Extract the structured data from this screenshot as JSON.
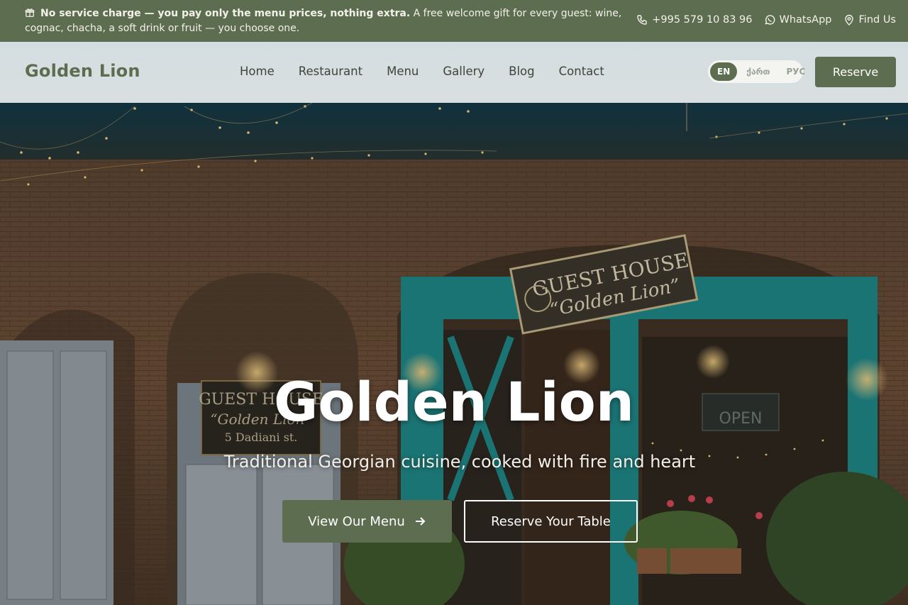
{
  "topbar": {
    "notice_bold": "No service charge — you pay only the menu prices, nothing extra.",
    "notice_text": " A free welcome gift for every guest: wine, cognac, chacha, a soft drink or fruit — you choose one.",
    "phone": "+995 579 10 83 96",
    "whatsapp": "WhatsApp",
    "find_us": "Find Us"
  },
  "header": {
    "logo": "Golden Lion",
    "nav": [
      "Home",
      "Restaurant",
      "Menu",
      "Gallery",
      "Blog",
      "Contact"
    ],
    "languages": [
      "EN",
      "ქართ",
      "РУС"
    ],
    "active_language": "EN",
    "reserve_label": "Reserve"
  },
  "hero": {
    "title": "Golden Lion",
    "subtitle": "Traditional Georgian cuisine, cooked with fire and heart",
    "menu_button": "View Our Menu",
    "reserve_button": "Reserve Your Table"
  },
  "photo_signs": {
    "hanging_sign_line1": "GUEST HOUSE",
    "hanging_sign_line2": "“Golden Lion”",
    "door_sign_line1": "GUEST HOUSE",
    "door_sign_line2": "“Golden Lion”",
    "door_sign_line3": "5 Dadiani st.",
    "window_sign": "OPEN"
  },
  "colors": {
    "brand_green": "#5d6d4f",
    "header_bg": "#d6dee0",
    "teal_frame": "#1d8a8c"
  }
}
